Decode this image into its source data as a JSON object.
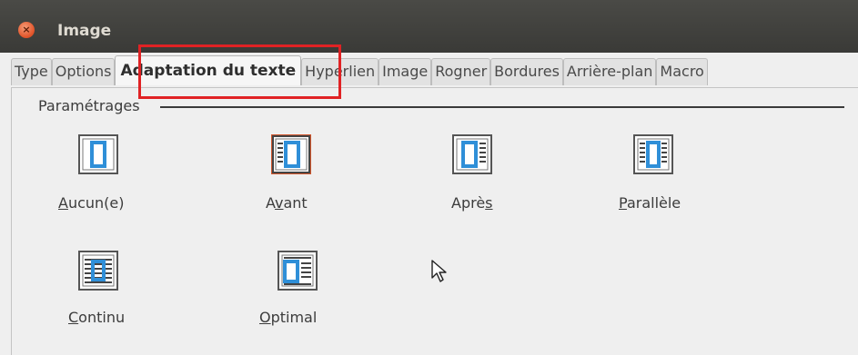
{
  "window": {
    "title": "Image"
  },
  "tabs": [
    "Type",
    "Options",
    "Adaptation du texte",
    "Hyperlien",
    "Image",
    "Rogner",
    "Bordures",
    "Arrière-plan",
    "Macro"
  ],
  "active_tab": "Adaptation du texte",
  "section": {
    "label": "Paramétrages"
  },
  "options": [
    {
      "pre": "",
      "key": "A",
      "post": "ucun(e)",
      "icon": "wrap-none-icon",
      "selected": false
    },
    {
      "pre": "A",
      "key": "v",
      "post": "ant",
      "icon": "wrap-before-icon",
      "selected": true
    },
    {
      "pre": "Aprè",
      "key": "s",
      "post": "",
      "icon": "wrap-after-icon",
      "selected": false
    },
    {
      "pre": "",
      "key": "P",
      "post": "arallèle",
      "icon": "wrap-parallel-icon",
      "selected": false
    },
    {
      "pre": "",
      "key": "C",
      "post": "ontinu",
      "icon": "wrap-through-icon",
      "selected": false
    },
    {
      "pre": "",
      "key": "O",
      "post": "ptimal",
      "icon": "wrap-optimal-icon",
      "selected": false
    }
  ],
  "colors": {
    "highlight": "#e02224",
    "icon_blue": "#2f8fd8",
    "selected_border": "#d2552b"
  }
}
